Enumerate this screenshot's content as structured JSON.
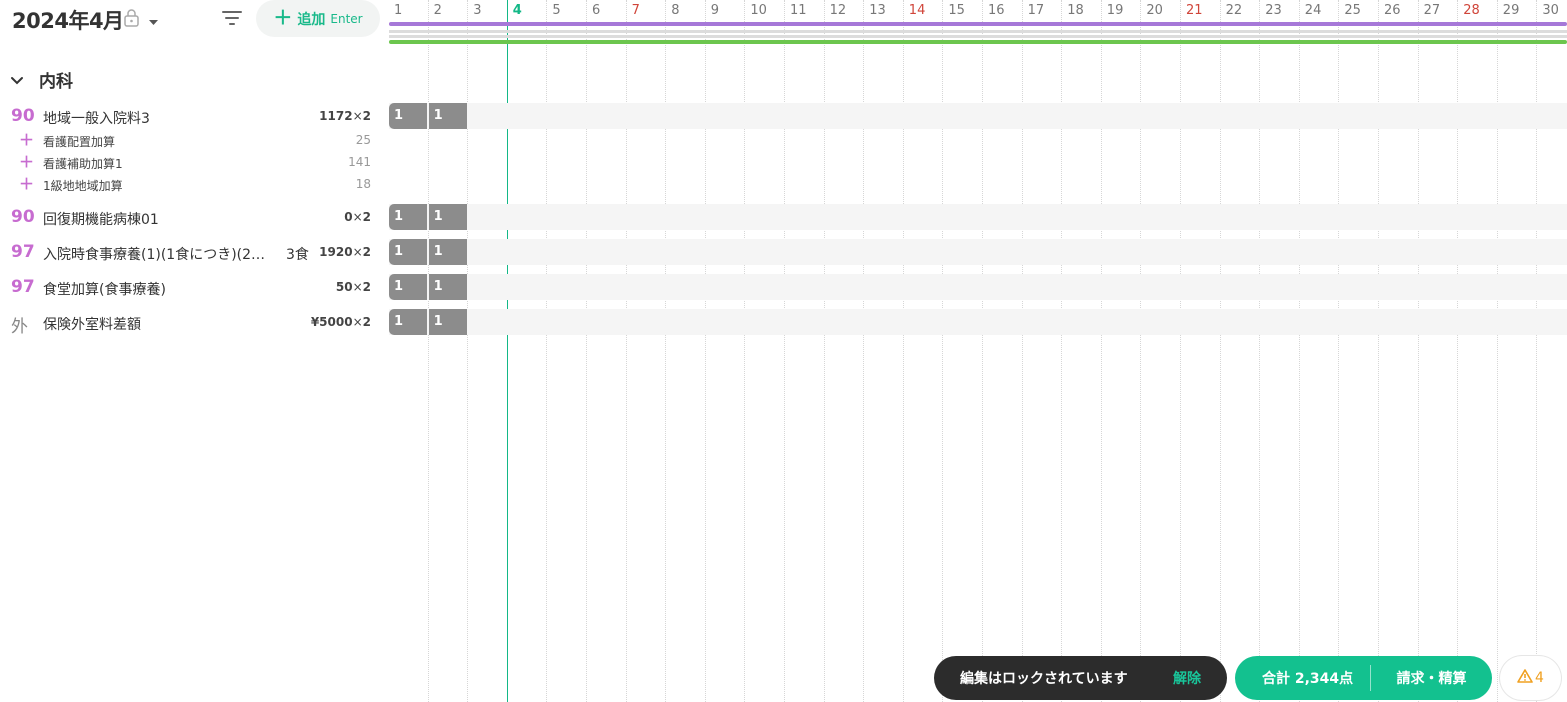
{
  "header": {
    "month_title": "2024年4月",
    "add_label": "追加",
    "add_shortcut": "Enter"
  },
  "calendar": {
    "days": [
      "1",
      "2",
      "3",
      "4",
      "5",
      "6",
      "7",
      "8",
      "9",
      "10",
      "11",
      "12",
      "13",
      "14",
      "15",
      "16",
      "17",
      "18",
      "19",
      "20",
      "21",
      "22",
      "23",
      "24",
      "25",
      "26",
      "27",
      "28",
      "29",
      "30"
    ],
    "sundays": [
      "7",
      "14",
      "21",
      "28"
    ],
    "today": "4"
  },
  "department": {
    "name": "内科",
    "expanded": true
  },
  "items": [
    {
      "code": "90",
      "name": "地域一般入院料3",
      "qty_value": "1172",
      "qty_count": "2",
      "cells": [
        "1",
        "1"
      ],
      "additions": [
        {
          "name": "看護配置加算",
          "value": "25"
        },
        {
          "name": "看護補助加算1",
          "value": "141"
        },
        {
          "name": "1級地地域加算",
          "value": "18"
        }
      ]
    },
    {
      "code": "90",
      "name": "回復期機能病棟01",
      "qty_value": "0",
      "qty_count": "2",
      "cells": [
        "1",
        "1"
      ],
      "additions": []
    },
    {
      "code": "97",
      "name": "入院時食事療養(1)(1食につき)(2…",
      "meal": "3食",
      "qty_value": "1920",
      "qty_count": "2",
      "cells": [
        "1",
        "1"
      ],
      "additions": []
    },
    {
      "code": "97",
      "name": "食堂加算(食事療養)",
      "qty_value": "50",
      "qty_count": "2",
      "cells": [
        "1",
        "1"
      ],
      "additions": []
    },
    {
      "code": "外",
      "name": "保険外室料差額",
      "qty_value": "¥5000",
      "qty_count": "2",
      "cells": [
        "1",
        "1"
      ],
      "additions": []
    }
  ],
  "footer": {
    "lock_message": "編集はロックされています",
    "unlock_label": "解除",
    "total_label": "合計",
    "total_value": "2,344点",
    "bill_label": "請求・精算",
    "warning_count": "4"
  },
  "colors": {
    "accent_green": "#13c18f",
    "code_purple": "#c76cd0",
    "sunday_red": "#d0453a"
  }
}
